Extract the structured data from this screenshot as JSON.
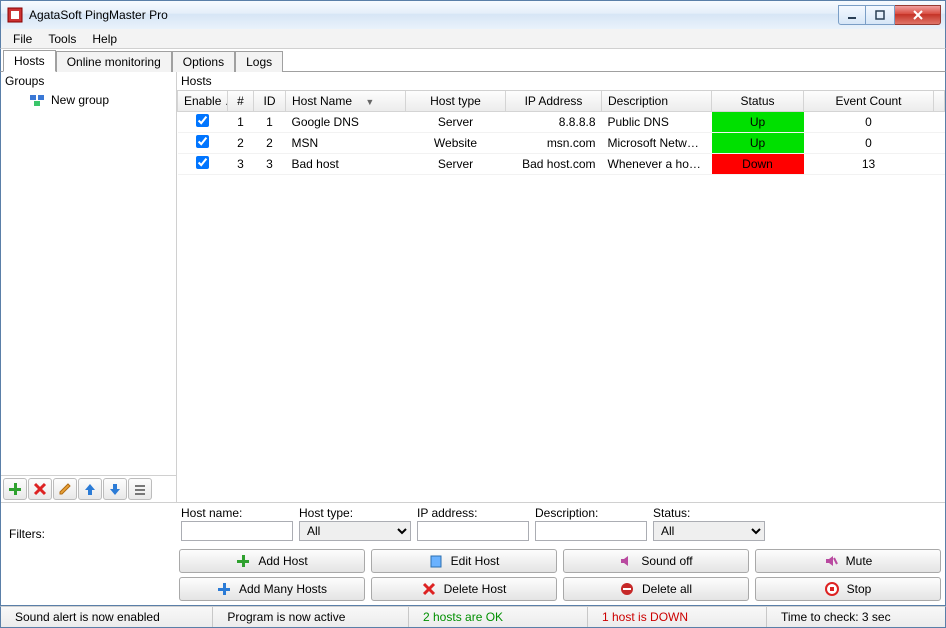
{
  "window": {
    "title": "AgataSoft PingMaster Pro"
  },
  "menu": {
    "file": "File",
    "tools": "Tools",
    "help": "Help"
  },
  "tabs": [
    {
      "label": "Hosts",
      "selected": true
    },
    {
      "label": "Online monitoring",
      "selected": false
    },
    {
      "label": "Options",
      "selected": false
    },
    {
      "label": "Logs",
      "selected": false
    }
  ],
  "groups_panel": {
    "title": "Groups",
    "nodes": [
      {
        "label": "New group"
      }
    ]
  },
  "hosts_panel": {
    "title": "Hosts",
    "columns": {
      "enable": "Enable …",
      "num": "#",
      "id": "ID",
      "name": "Host Name",
      "type": "Host type",
      "ip": "IP Address",
      "desc": "Description",
      "status": "Status",
      "events": "Event Count"
    },
    "rows": [
      {
        "enabled": true,
        "num": "1",
        "id": "1",
        "name": "Google DNS",
        "type": "Server",
        "ip": "8.8.8.8",
        "desc": "Public DNS",
        "status": "Up",
        "status_kind": "up",
        "events": "0"
      },
      {
        "enabled": true,
        "num": "2",
        "id": "2",
        "name": "MSN",
        "type": "Website",
        "ip": "msn.com",
        "desc": "Microsoft Network …",
        "status": "Up",
        "status_kind": "up",
        "events": "0"
      },
      {
        "enabled": true,
        "num": "3",
        "id": "3",
        "name": "Bad host",
        "type": "Server",
        "ip": "Bad host.com",
        "desc": "Whenever a host is…",
        "status": "Down",
        "status_kind": "down",
        "events": "13"
      }
    ]
  },
  "filters": {
    "label": "Filters:",
    "hostname_cap": "Host name:",
    "hostname_val": "",
    "hosttype_cap": "Host type:",
    "hosttype_val": "All",
    "ip_cap": "IP address:",
    "ip_val": "",
    "desc_cap": "Description:",
    "desc_val": "",
    "status_cap": "Status:",
    "status_val": "All"
  },
  "buttons": {
    "add_host": "Add Host",
    "edit_host": "Edit Host",
    "sound_off": "Sound off",
    "mute": "Mute",
    "add_many": "Add Many Hosts",
    "delete_host": "Delete Host",
    "delete_all": "Delete all",
    "stop": "Stop"
  },
  "statusbar": {
    "sound": "Sound alert is now enabled",
    "program": "Program is now active",
    "ok": "2 hosts are OK",
    "down": "1 host is DOWN",
    "timer": "Time to check: 3 sec"
  }
}
